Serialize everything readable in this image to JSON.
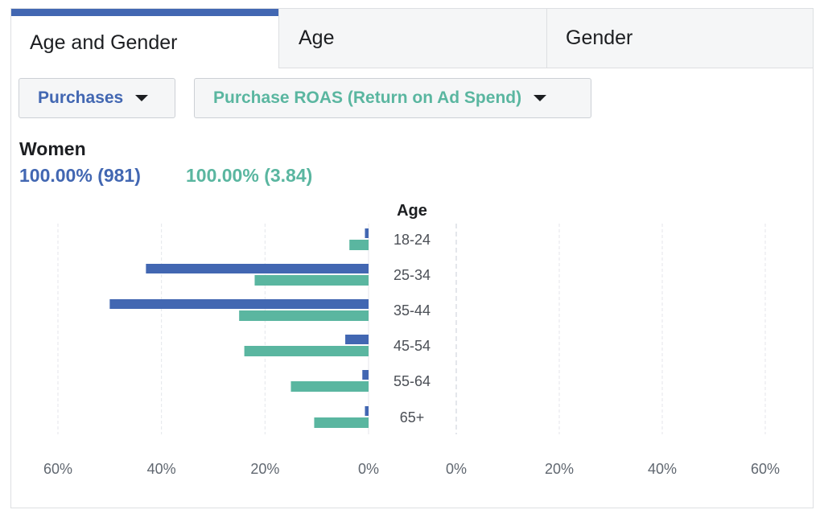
{
  "tabs": [
    {
      "label": "Age and Gender",
      "active": true
    },
    {
      "label": "Age",
      "active": false
    },
    {
      "label": "Gender",
      "active": false
    }
  ],
  "dropdowns": {
    "metric1": "Purchases",
    "metric2": "Purchase ROAS (Return on Ad Spend)"
  },
  "summary": {
    "title": "Women",
    "metric1_value": "100.00% (981)",
    "metric2_value": "100.00% (3.84)"
  },
  "colors": {
    "blue": "#4267b2",
    "green": "#5ab6a0",
    "grid": "#e4e6eb",
    "text": "#1c1e21"
  },
  "chart_data": {
    "type": "bar",
    "orientation": "horizontal-butterfly",
    "center_label": "Age",
    "categories": [
      "18-24",
      "25-34",
      "35-44",
      "45-54",
      "55-64",
      "65+"
    ],
    "left_panel": {
      "label": "Women",
      "series": [
        {
          "name": "Purchases",
          "color": "#4267b2",
          "values": [
            0.7,
            43,
            50,
            4.5,
            1.2,
            0.7
          ]
        },
        {
          "name": "Purchase ROAS (Return on Ad Spend)",
          "color": "#5ab6a0",
          "values": [
            3.7,
            22,
            25,
            24,
            15,
            10.5
          ]
        }
      ]
    },
    "right_panel": {
      "series": []
    },
    "left_ticks": [
      "60%",
      "40%",
      "20%",
      "0%"
    ],
    "right_ticks": [
      "0%",
      "20%",
      "40%",
      "60%"
    ],
    "xlim": [
      0,
      60
    ],
    "grid": true
  }
}
